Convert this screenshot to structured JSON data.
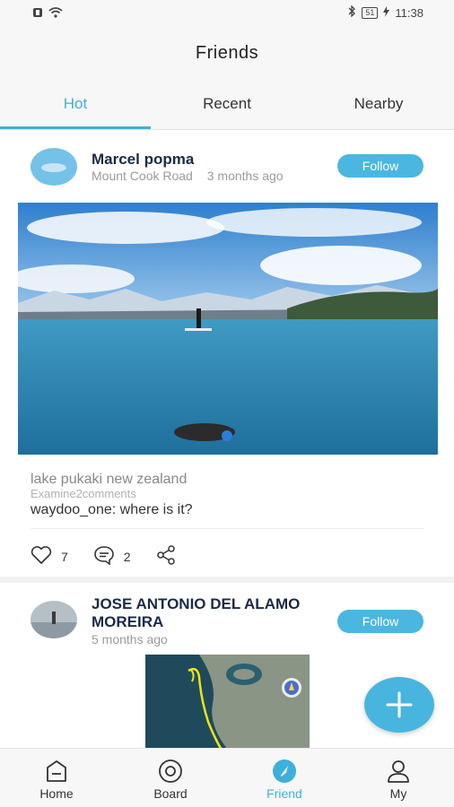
{
  "status_bar": {
    "battery": "51",
    "time": "11:38"
  },
  "header": {
    "title": "Friends"
  },
  "tabs": [
    {
      "label": "Hot",
      "active": true
    },
    {
      "label": "Recent",
      "active": false
    },
    {
      "label": "Nearby",
      "active": false
    }
  ],
  "posts": [
    {
      "author": "Marcel popma",
      "location": "Mount Cook Road",
      "time": "3 months ago",
      "follow_label": "Follow",
      "caption": "lake pukaki new zealand",
      "comments_label": "Examine2comments",
      "comment": "waydoo_one: where is it?",
      "likes": "7",
      "comments": "2"
    },
    {
      "author_line1": "JOSE ANTONIO DEL ALAMO",
      "author_line2": "MOREIRA",
      "time": "5 months ago",
      "follow_label": "Follow"
    }
  ],
  "bottom_nav": [
    {
      "label": "Home",
      "icon": "home-icon",
      "active": false
    },
    {
      "label": "Board",
      "icon": "board-icon",
      "active": false
    },
    {
      "label": "Friend",
      "icon": "compass-icon",
      "active": true
    },
    {
      "label": "My",
      "icon": "user-icon",
      "active": false
    }
  ],
  "colors": {
    "accent": "#3fb0d9",
    "follow_button": "#4ab7e0",
    "author_text": "#1b2a45"
  }
}
